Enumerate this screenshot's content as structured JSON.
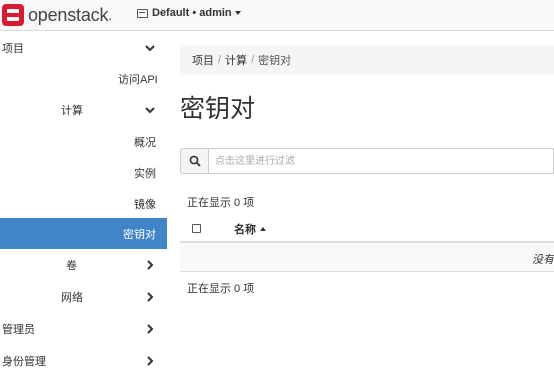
{
  "navbar": {
    "brand": "openstack",
    "brand_dot": ".",
    "project": "Default • admin"
  },
  "sidebar": {
    "items": [
      {
        "label": "项目"
      },
      {
        "label": "访问API"
      },
      {
        "label": "计算"
      },
      {
        "label": "概况"
      },
      {
        "label": "实例"
      },
      {
        "label": "镜像"
      },
      {
        "label": "密钥对"
      },
      {
        "label": "卷"
      },
      {
        "label": "网络"
      },
      {
        "label": "管理员"
      },
      {
        "label": "身份管理"
      }
    ]
  },
  "breadcrumb": [
    "项目",
    "计算",
    "密钥对"
  ],
  "page_title": "密钥对",
  "search": {
    "placeholder": "点击这里进行过滤"
  },
  "count_top": "正在显示 0 项",
  "table": {
    "col_name": "名称",
    "empty": "没有"
  },
  "count_bottom": "正在显示 0 项",
  "colors": {
    "accent": "#3f85c7",
    "brand": "#da1a32"
  }
}
